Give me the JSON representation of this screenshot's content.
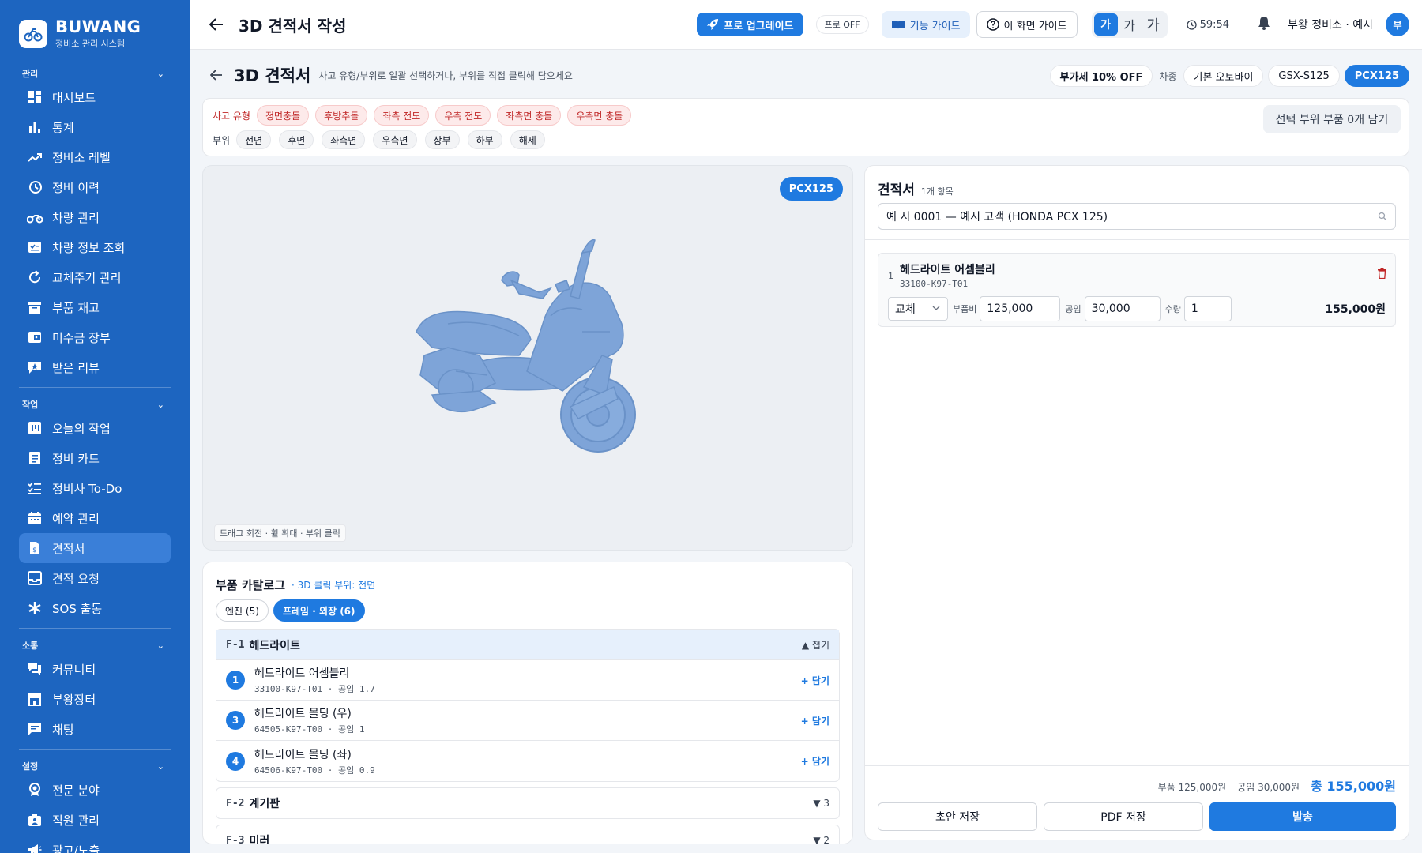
{
  "brand": {
    "name": "BUWANG",
    "subtitle": "정비소 관리 시스템"
  },
  "sidebar": {
    "sections": [
      {
        "title": "관리",
        "items": [
          "대시보드",
          "통계",
          "정비소 레벨",
          "정비 이력",
          "차량 관리",
          "차량 정보 조회",
          "교체주기 관리",
          "부품 재고",
          "미수금 장부",
          "받은 리뷰"
        ]
      },
      {
        "title": "작업",
        "items": [
          "오늘의 작업",
          "정비 카드",
          "정비사 To-Do",
          "예약 관리",
          "견적서",
          "견적 요청",
          "SOS 출동"
        ]
      },
      {
        "title": "소통",
        "items": [
          "커뮤니티",
          "부왕장터",
          "채팅"
        ]
      },
      {
        "title": "설정",
        "items": [
          "전문 분야",
          "직원 관리",
          "광고/노출"
        ]
      }
    ]
  },
  "header": {
    "title": "3D 견적서 작성",
    "pro_button": "프로 업그레이드",
    "pro_status": "프로 OFF",
    "feature_guide": "기능 가이드",
    "screen_guide": "이 화면 가이드",
    "font_sizes": [
      "가",
      "가",
      "가"
    ],
    "timer": "59:54",
    "user_name": "부왕 정비소 · 예시",
    "avatar_initial": "부"
  },
  "page": {
    "title": "3D 견적서",
    "subtitle": "사고 유형/부위로 일괄 선택하거나, 부위를 직접 클릭해 담으세요",
    "vat_chip": "부가세 10% OFF",
    "vehicle_label": "차종",
    "vehicles": [
      "기본 오토바이",
      "GSX-S125",
      "PCX125"
    ],
    "accident_label": "사고 유형",
    "accidents": [
      "정면충돌",
      "후방추돌",
      "좌측 전도",
      "우측 전도",
      "좌측면 충돌",
      "우측면 충돌"
    ],
    "part_label": "부위",
    "parts": [
      "전면",
      "후면",
      "좌측면",
      "우측면",
      "상부",
      "하부",
      "해제"
    ],
    "add_selected": "선택 부위 부품 0개 담기"
  },
  "viewer": {
    "model_badge": "PCX125",
    "hint": "드래그 회전 · 휠 확대 · 부위 클릭"
  },
  "catalog": {
    "title": "부품 카탈로그",
    "subtitle": "· 3D 클릭 부위: 전면",
    "tabs": [
      "엔진 (5)",
      "프레임 · 외장 (6)"
    ],
    "groups": [
      {
        "code": "F-1",
        "name": "헤드라이트",
        "right": "▲ 접기",
        "items": [
          {
            "num": "1",
            "name": "헤드라이트 어셈블리",
            "meta": "33100-K97-T01 · 공임 1.7",
            "add": "+ 담기"
          },
          {
            "num": "3",
            "name": "헤드라이트 몰딩 (우)",
            "meta": "64505-K97-T00 · 공임 1",
            "add": "+ 담기"
          },
          {
            "num": "4",
            "name": "헤드라이트 몰딩 (좌)",
            "meta": "64506-K97-T00 · 공임 0.9",
            "add": "+ 담기"
          }
        ]
      },
      {
        "code": "F-2",
        "name": "계기판",
        "right": "▼ 3"
      },
      {
        "code": "F-3",
        "name": "미러",
        "right": "▼ 2"
      }
    ]
  },
  "estimate": {
    "title": "견적서",
    "count": "1개 항목",
    "customer": "예 시 0001 — 예시 고객 (HONDA PCX 125)",
    "line": {
      "index": "1",
      "name": "헤드라이트 어셈블리",
      "code": "33100-K97-T01",
      "type": "교체",
      "part_label": "부품비",
      "part_cost": "125,000",
      "labor_label": "공임",
      "labor_cost": "30,000",
      "qty_label": "수량",
      "qty": "1",
      "total": "155,000원"
    },
    "summary": {
      "parts": "부품 125,000원",
      "labor": "공임 30,000원",
      "total": "총 155,000원"
    },
    "buttons": {
      "draft": "초안 저장",
      "pdf": "PDF 저장",
      "send": "발송"
    }
  },
  "colors": {
    "primary": "#1f7ae0",
    "sidebar": "#1d65c0",
    "danger": "#c02626"
  }
}
